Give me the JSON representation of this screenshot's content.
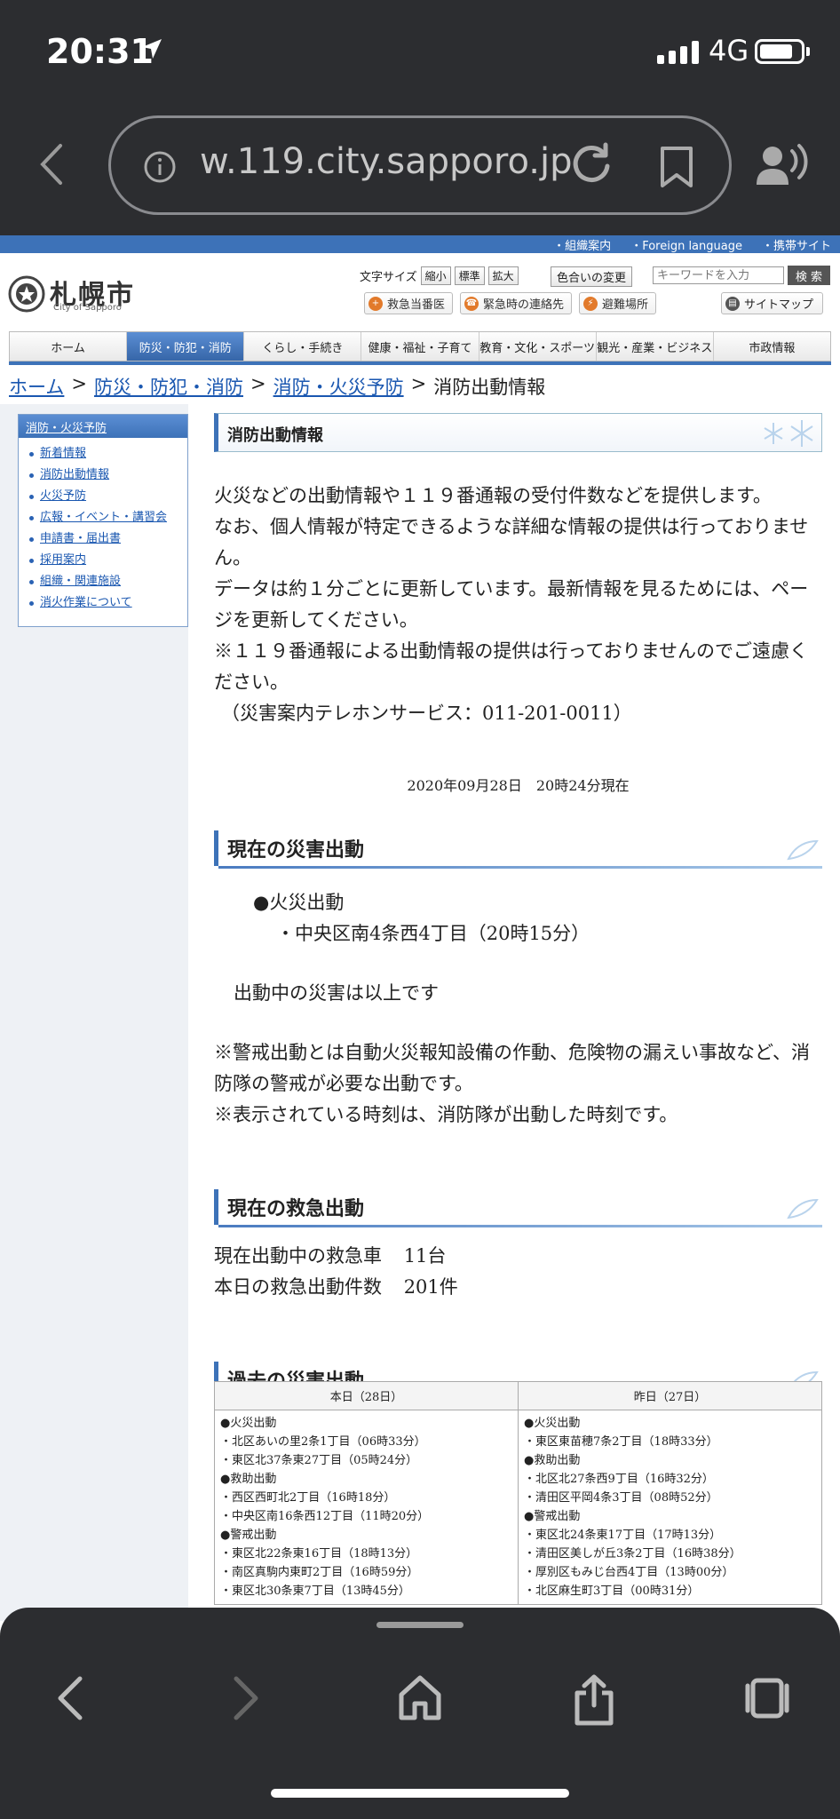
{
  "status": {
    "time": "20:31",
    "network": "4G"
  },
  "browser": {
    "url": "w.119.city.sapporo.jp"
  },
  "util_links": [
    "・組織案内",
    "・Foreign language",
    "・携帯サイト"
  ],
  "logo": {
    "name": "札幌市",
    "sub": "City of Sapporo"
  },
  "font_size": {
    "label": "文字サイズ",
    "small": "縮小",
    "normal": "標準",
    "large": "拡大"
  },
  "color_change": "色合いの変更",
  "search": {
    "placeholder": "キーワードを入力",
    "button": "検 索"
  },
  "services": [
    {
      "icon": "hospital-icon",
      "label": "救急当番医"
    },
    {
      "icon": "phone-icon",
      "label": "緊急時の連絡先"
    },
    {
      "icon": "shelter-icon",
      "label": "避難場所"
    }
  ],
  "sitemap": "サイトマップ",
  "gnav": [
    "ホーム",
    "防災・防犯・消防",
    "くらし・手続き",
    "健康・福祉・子育て",
    "教育・文化・スポーツ",
    "観光・産業・ビジネス",
    "市政情報"
  ],
  "breadcrumb": {
    "items": [
      "ホーム",
      "防災・防犯・消防",
      "消防・火災予防"
    ],
    "current": "消防出動情報",
    "sep": ">"
  },
  "sidebar": {
    "title": "消防・火災予防",
    "items": [
      "新着情報",
      "消防出動情報",
      "火災予防",
      "広報・イベント・講習会",
      "申請書・届出書",
      "採用案内",
      "組織・関連施設",
      "消火作業について"
    ]
  },
  "main": {
    "title": "消防出動情報",
    "intro": [
      "火災などの出動情報や１１９番通報の受付件数などを提供します。",
      "なお、個人情報が特定できるような詳細な情報の提供は行っておりません。",
      "データは約１分ごとに更新しています。最新情報を見るためには、ページを更新してください。",
      "※１１９番通報による出動情報の提供は行っておりませんのでご遠慮ください。",
      "（災害案内テレホンサービス：011-201-0011）"
    ],
    "updated": "2020年09月28日　20時24分現在",
    "current_disaster": {
      "heading": "現在の災害出動",
      "category": "●火災出動",
      "entry": "・中央区南4条西4丁目（20時15分）",
      "end_note": "出動中の災害は以上です",
      "notes": [
        "※警戒出動とは自動火災報知設備の作動、危険物の漏えい事故など、消防隊の警戒が必要な出動です。",
        "※表示されている時刻は、消防隊が出動した時刻です。"
      ]
    },
    "ambulance": {
      "heading": "現在の救急出動",
      "active_label": "現在出動中の救急車",
      "active_value": "11台",
      "today_label": "本日の救急出動件数",
      "today_value": "201件"
    },
    "past": {
      "heading": "過去の災害出動",
      "today_header": "本日（28日）",
      "yesterday_header": "昨日（27日）",
      "today": [
        "●火災出動",
        "・北区あいの里2条1丁目（06時33分）",
        "・東区北37条東27丁目（05時24分）",
        "●救助出動",
        "・西区西町北2丁目（16時18分）",
        "・中央区南16条西12丁目（11時20分）",
        "●警戒出動",
        "・東区北22条東16丁目（18時13分）",
        "・南区真駒内東町2丁目（16時59分）",
        "・東区北30条東7丁目（13時45分）"
      ],
      "yesterday": [
        "●火災出動",
        "・東区東苗穂7条2丁目（18時33分）",
        "●救助出動",
        "・北区北27条西9丁目（16時32分）",
        "・清田区平岡4条3丁目（08時52分）",
        "●警戒出動",
        "・東区北24条東17丁目（17時13分）",
        "・清田区美しが丘3条2丁目（16時38分）",
        "・厚別区もみじ台西4丁目（13時00分）",
        "・北区麻生町3丁目（00時31分）"
      ]
    }
  }
}
